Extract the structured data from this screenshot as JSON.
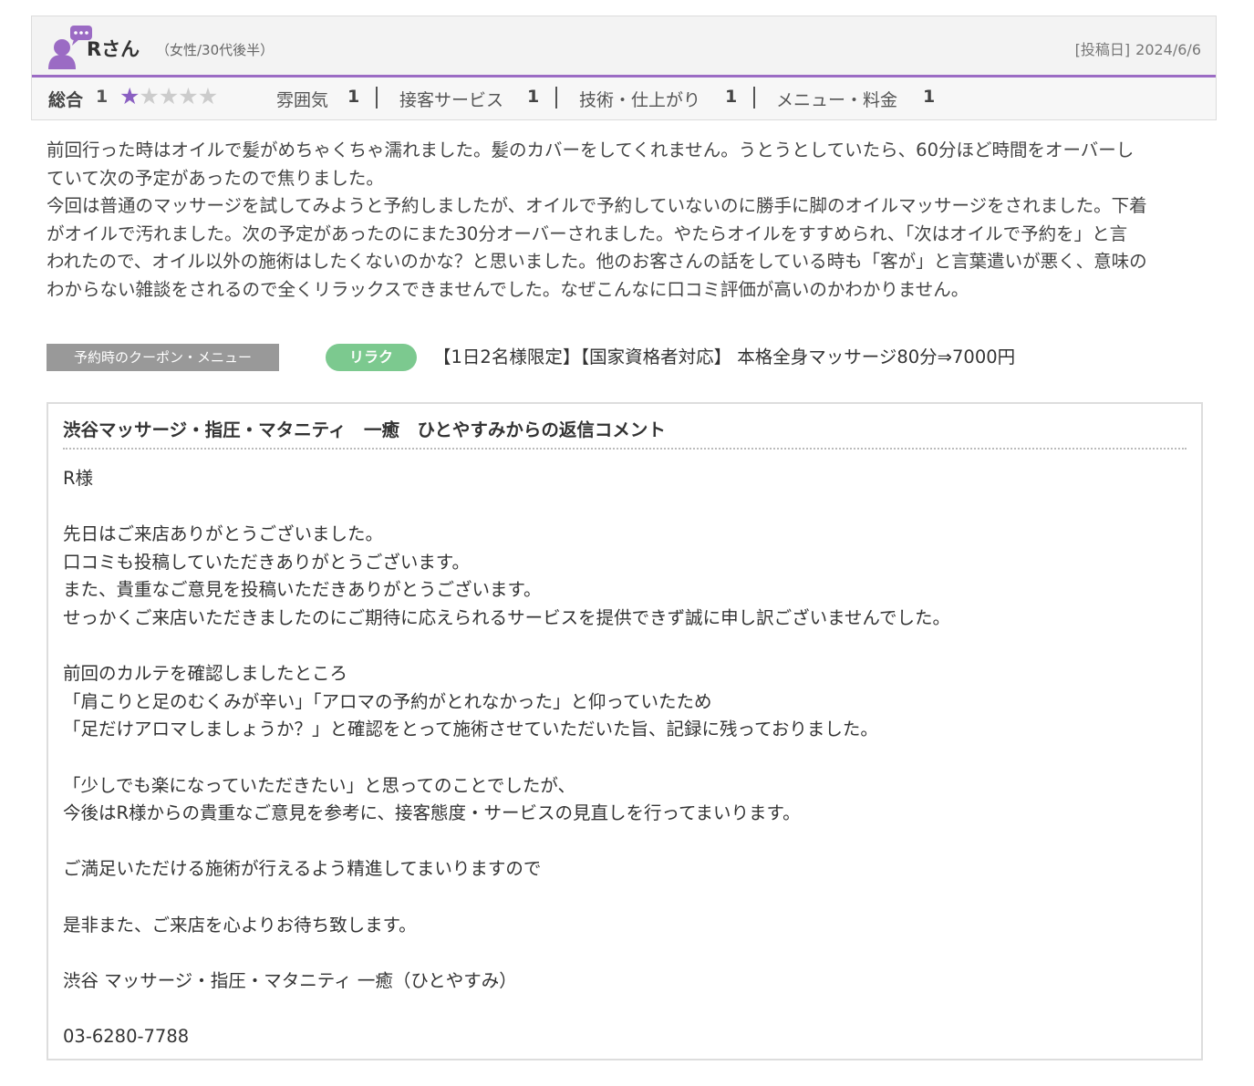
{
  "review": {
    "user_name": "Rさん",
    "user_attributes": "（女性/30代後半）",
    "post_date_label": "[投稿日]",
    "post_date": "2024/6/6",
    "avatar_icon": "user-speech-icon",
    "accent_color": "#9b6bc4",
    "ratings": {
      "total_label": "総合",
      "total_value": "1",
      "stars_filled": 1,
      "stars_total": 5,
      "items": [
        {
          "label": "雰囲気",
          "value": "1"
        },
        {
          "label": "接客サービス",
          "value": "1"
        },
        {
          "label": "技術・仕上がり",
          "value": "1"
        },
        {
          "label": "メニュー・料金",
          "value": "1"
        }
      ]
    },
    "body": [
      "前回行った時はオイルで髪がめちゃくちゃ濡れました。髪のカバーをしてくれません。うとうとしていたら、60分ほど時間をオーバーし",
      "ていて次の予定があったので焦りました。",
      "今回は普通のマッサージを試してみようと予約しましたが、オイルで予約していないのに勝手に脚のオイルマッサージをされました。下着",
      "がオイルで汚れました。次の予定があったのにまた30分オーバーされました。やたらオイルをすすめられ、「次はオイルで予約を」と言",
      "われたので、オイル以外の施術はしたくないのかな？と思いました。他のお客さんの話をしている時も「客が」と言葉遣いが悪く、意味の",
      "わからない雑談をされるので全くリラックスできませんでした。なぜこんなに口コミ評価が高いのかわかりません。"
    ]
  },
  "coupon": {
    "tag_label": "予約時のクーポン・メニュー",
    "badge_label": "リラク",
    "badge_color": "#7cc98f",
    "menu_text": "【1日2名様限定】【国家資格者対応】 本格全身マッサージ80分⇒7000円"
  },
  "reply": {
    "title": "渋谷マッサージ・指圧・マタニティ　一癒　ひとやすみからの返信コメント",
    "lines": [
      "R様",
      "",
      "先日はご来店ありがとうございました。",
      "口コミも投稿していただきありがとうございます。",
      "また、貴重なご意見を投稿いただきありがとうございます。",
      "せっかくご来店いただきましたのにご期待に応えられるサービスを提供できず誠に申し訳ございませんでした。",
      "",
      "前回のカルテを確認しましたところ",
      "「肩こりと足のむくみが辛い」「アロマの予約がとれなかった」と仰っていたため",
      "「足だけアロマしましょうか？」と確認をとって施術させていただいた旨、記録に残っておりました。",
      "",
      "「少しでも楽になっていただきたい」と思ってのことでしたが、",
      "今後はR様からの貴重なご意見を参考に、接客態度・サービスの見直しを行ってまいります。",
      "",
      "ご満足いただける施術が行えるよう精進してまいりますので",
      "",
      "是非また、ご来店を心よりお待ち致します。",
      "",
      "渋谷 マッサージ・指圧・マタニティ 一癒（ひとやすみ）",
      "",
      "03-6280-7788"
    ]
  }
}
